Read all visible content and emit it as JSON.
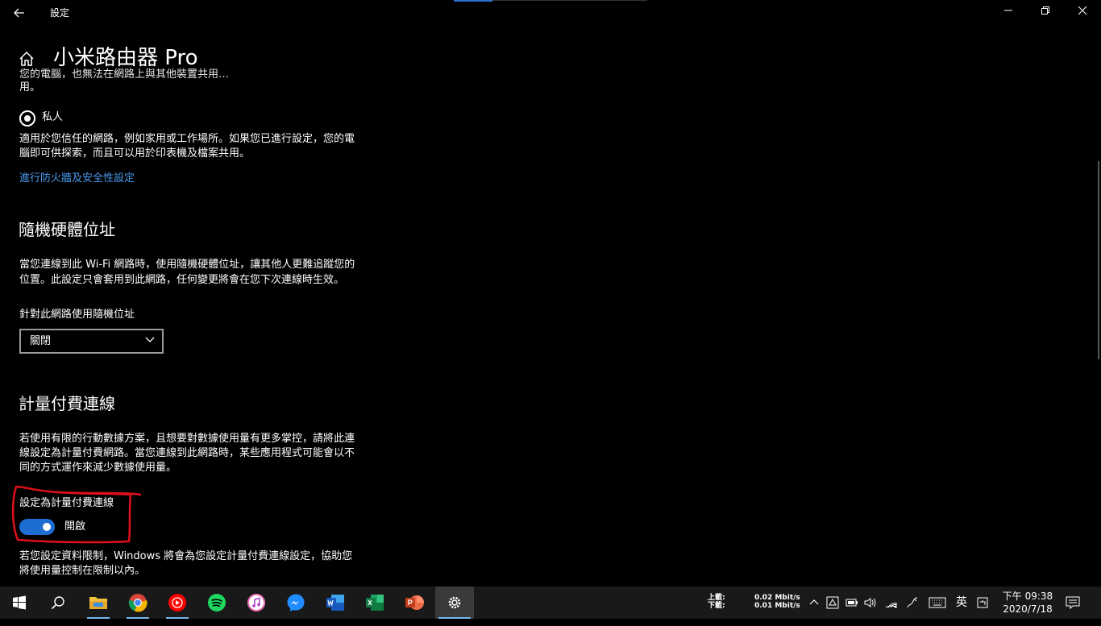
{
  "window": {
    "app_title": "設定",
    "page_title": "小米路由器 Pro"
  },
  "network_profile": {
    "truncated_text_1": "您的電腦，也無法在網路上與其他裝置共用…",
    "truncated_text_2": "用。",
    "private_label": "私人",
    "private_desc_line1": "適用於您信任的網路，例如家用或工作場所。如果您已進行設定，您的電",
    "private_desc_line2": "腦即可供探索，而且可以用於印表機及檔案共用。",
    "firewall_link": "進行防火牆及安全性設定"
  },
  "random_hw": {
    "heading": "隨機硬體位址",
    "desc_line1": "當您連線到此 Wi-Fi 網路時，使用隨機硬體位址，讓其他人更難追蹤您的",
    "desc_line2": "位置。此設定只會套用到此網路，任何變更將會在您下次連線時生效。",
    "field_label": "針對此網路使用隨機位址",
    "dropdown_value": "關閉"
  },
  "metered": {
    "heading": "計量付費連線",
    "desc_line1": "若使用有限的行動數據方案，且想要對數據使用量有更多掌控，請將此連",
    "desc_line2": "線設定為計量付費網路。當您連線到此網路時，某些應用程式可能會以不",
    "desc_line3": "同的方式運作來減少數據使用量。",
    "toggle_label": "設定為計量付費連線",
    "toggle_state": "開啟",
    "toggle_on": true,
    "note_line1": "若您設定資料限制，Windows 將會為您設定計量付費連線設定，協助您",
    "note_line2": "將使用量控制在限制以內。"
  },
  "taskbar": {
    "apps": [
      "start-icon",
      "search-icon",
      "file-explorer-icon",
      "chrome-icon",
      "youtube-music-icon",
      "spotify-icon",
      "itunes-icon",
      "messenger-icon",
      "word-icon",
      "excel-icon",
      "powerpoint-icon",
      "settings-icon"
    ],
    "net_labels": {
      "up": "上載:",
      "down": "下載:"
    },
    "net_values": {
      "up": "0.02 Mbit/s",
      "down": "0.01 Mbit/s"
    },
    "ime": "英",
    "clock_time": "下午 09:38",
    "clock_date": "2020/7/18"
  },
  "colors": {
    "accent": "#1e6dd2",
    "link": "#4b9bf0",
    "annotation": "#e0101a",
    "background": "#000000",
    "taskbar": "#191919"
  }
}
